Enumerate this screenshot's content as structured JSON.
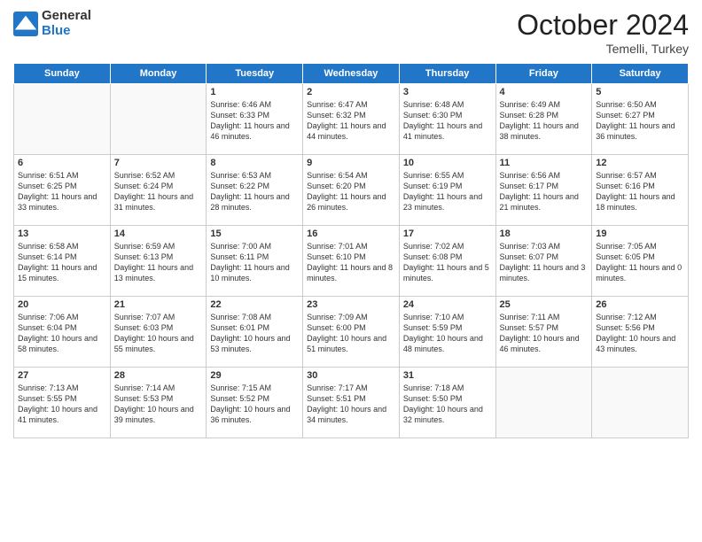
{
  "header": {
    "logo": {
      "general": "General",
      "blue": "Blue"
    },
    "title": "October 2024",
    "subtitle": "Temelli, Turkey"
  },
  "weekdays": [
    "Sunday",
    "Monday",
    "Tuesday",
    "Wednesday",
    "Thursday",
    "Friday",
    "Saturday"
  ],
  "weeks": [
    [
      {
        "day": null
      },
      {
        "day": null
      },
      {
        "day": 1,
        "sunrise": "6:46 AM",
        "sunset": "6:33 PM",
        "daylight": "11 hours and 46 minutes."
      },
      {
        "day": 2,
        "sunrise": "6:47 AM",
        "sunset": "6:32 PM",
        "daylight": "11 hours and 44 minutes."
      },
      {
        "day": 3,
        "sunrise": "6:48 AM",
        "sunset": "6:30 PM",
        "daylight": "11 hours and 41 minutes."
      },
      {
        "day": 4,
        "sunrise": "6:49 AM",
        "sunset": "6:28 PM",
        "daylight": "11 hours and 38 minutes."
      },
      {
        "day": 5,
        "sunrise": "6:50 AM",
        "sunset": "6:27 PM",
        "daylight": "11 hours and 36 minutes."
      }
    ],
    [
      {
        "day": 6,
        "sunrise": "6:51 AM",
        "sunset": "6:25 PM",
        "daylight": "11 hours and 33 minutes."
      },
      {
        "day": 7,
        "sunrise": "6:52 AM",
        "sunset": "6:24 PM",
        "daylight": "11 hours and 31 minutes."
      },
      {
        "day": 8,
        "sunrise": "6:53 AM",
        "sunset": "6:22 PM",
        "daylight": "11 hours and 28 minutes."
      },
      {
        "day": 9,
        "sunrise": "6:54 AM",
        "sunset": "6:20 PM",
        "daylight": "11 hours and 26 minutes."
      },
      {
        "day": 10,
        "sunrise": "6:55 AM",
        "sunset": "6:19 PM",
        "daylight": "11 hours and 23 minutes."
      },
      {
        "day": 11,
        "sunrise": "6:56 AM",
        "sunset": "6:17 PM",
        "daylight": "11 hours and 21 minutes."
      },
      {
        "day": 12,
        "sunrise": "6:57 AM",
        "sunset": "6:16 PM",
        "daylight": "11 hours and 18 minutes."
      }
    ],
    [
      {
        "day": 13,
        "sunrise": "6:58 AM",
        "sunset": "6:14 PM",
        "daylight": "11 hours and 15 minutes."
      },
      {
        "day": 14,
        "sunrise": "6:59 AM",
        "sunset": "6:13 PM",
        "daylight": "11 hours and 13 minutes."
      },
      {
        "day": 15,
        "sunrise": "7:00 AM",
        "sunset": "6:11 PM",
        "daylight": "11 hours and 10 minutes."
      },
      {
        "day": 16,
        "sunrise": "7:01 AM",
        "sunset": "6:10 PM",
        "daylight": "11 hours and 8 minutes."
      },
      {
        "day": 17,
        "sunrise": "7:02 AM",
        "sunset": "6:08 PM",
        "daylight": "11 hours and 5 minutes."
      },
      {
        "day": 18,
        "sunrise": "7:03 AM",
        "sunset": "6:07 PM",
        "daylight": "11 hours and 3 minutes."
      },
      {
        "day": 19,
        "sunrise": "7:05 AM",
        "sunset": "6:05 PM",
        "daylight": "11 hours and 0 minutes."
      }
    ],
    [
      {
        "day": 20,
        "sunrise": "7:06 AM",
        "sunset": "6:04 PM",
        "daylight": "10 hours and 58 minutes."
      },
      {
        "day": 21,
        "sunrise": "7:07 AM",
        "sunset": "6:03 PM",
        "daylight": "10 hours and 55 minutes."
      },
      {
        "day": 22,
        "sunrise": "7:08 AM",
        "sunset": "6:01 PM",
        "daylight": "10 hours and 53 minutes."
      },
      {
        "day": 23,
        "sunrise": "7:09 AM",
        "sunset": "6:00 PM",
        "daylight": "10 hours and 51 minutes."
      },
      {
        "day": 24,
        "sunrise": "7:10 AM",
        "sunset": "5:59 PM",
        "daylight": "10 hours and 48 minutes."
      },
      {
        "day": 25,
        "sunrise": "7:11 AM",
        "sunset": "5:57 PM",
        "daylight": "10 hours and 46 minutes."
      },
      {
        "day": 26,
        "sunrise": "7:12 AM",
        "sunset": "5:56 PM",
        "daylight": "10 hours and 43 minutes."
      }
    ],
    [
      {
        "day": 27,
        "sunrise": "7:13 AM",
        "sunset": "5:55 PM",
        "daylight": "10 hours and 41 minutes."
      },
      {
        "day": 28,
        "sunrise": "7:14 AM",
        "sunset": "5:53 PM",
        "daylight": "10 hours and 39 minutes."
      },
      {
        "day": 29,
        "sunrise": "7:15 AM",
        "sunset": "5:52 PM",
        "daylight": "10 hours and 36 minutes."
      },
      {
        "day": 30,
        "sunrise": "7:17 AM",
        "sunset": "5:51 PM",
        "daylight": "10 hours and 34 minutes."
      },
      {
        "day": 31,
        "sunrise": "7:18 AM",
        "sunset": "5:50 PM",
        "daylight": "10 hours and 32 minutes."
      },
      {
        "day": null
      },
      {
        "day": null
      }
    ]
  ],
  "labels": {
    "sunrise": "Sunrise:",
    "sunset": "Sunset:",
    "daylight": "Daylight:"
  }
}
